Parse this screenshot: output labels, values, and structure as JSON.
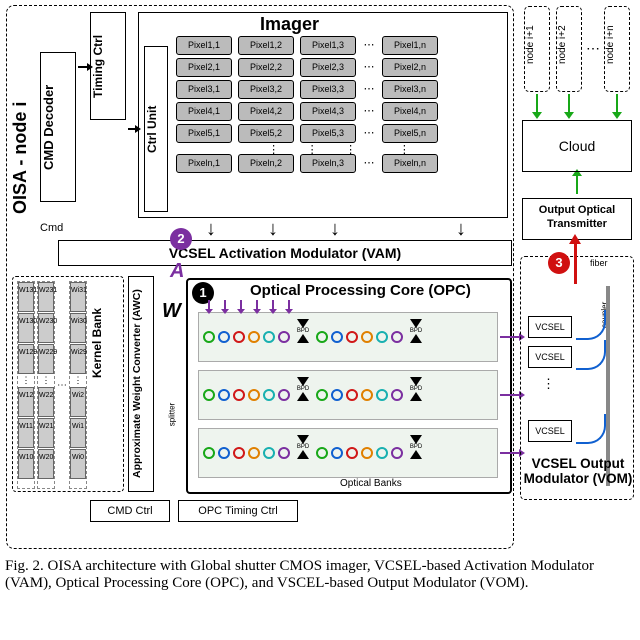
{
  "caption": "Fig. 2.  OISA architecture with Global shutter CMOS imager, VCSEL-based Activation Modulator (VAM), Optical Processing Core (OPC), and VSCEL-based Output Modulator (VOM).",
  "oisa_label": "OISA - node i",
  "blocks": {
    "cmd_decoder": "CMD Decoder",
    "timing_ctrl": "Timing Ctrl",
    "ctrl_unit": "Ctrl Unit",
    "imager_title": "Imager",
    "vam": "VCSEL Activation Modulator (VAM)",
    "kernel_bank": "Kernel Bank",
    "awc": "Approximate Weight Converter (AWC)",
    "opc_title": "Optical Processing Core (OPC)",
    "optical_banks": "Optical Banks",
    "splitter": "splitter",
    "cmd_ctrl": "CMD Ctrl",
    "opc_timing": "OPC Timing Ctrl",
    "cmd_input": "Cmd",
    "cloud": "Cloud",
    "oot": "Output Optical Transmitter",
    "vcsel": "VCSEL",
    "fiber": "fiber",
    "coupler": "coupler",
    "vom_title": "VCSEL Output Modulator (VOM)",
    "bpd": "BPD"
  },
  "badges": {
    "b1": "1",
    "b2": "2",
    "b3": "3"
  },
  "labels": {
    "A": "A",
    "W": "W"
  },
  "nodes": [
    "node i+1",
    "node i+2",
    "node i+n"
  ],
  "pixel_rows": [
    [
      "Pixel1,1",
      "Pixel1,2",
      "Pixel1,3",
      "Pixel1,n"
    ],
    [
      "Pixel2,1",
      "Pixel2,2",
      "Pixel2,3",
      "Pixel2,n"
    ],
    [
      "Pixel3,1",
      "Pixel3,2",
      "Pixel3,3",
      "Pixel3,n"
    ],
    [
      "Pixel4,1",
      "Pixel4,2",
      "Pixel4,3",
      "Pixel4,n"
    ],
    [
      "Pixel5,1",
      "Pixel5,2",
      "Pixel5,3",
      "Pixel5,n"
    ],
    [
      "Pixeln,1",
      "Pixeln,2",
      "Pixeln,3",
      "Pixeln,n"
    ]
  ],
  "kernel_cols": [
    [
      "W131",
      "W130",
      "W129",
      "W12",
      "W11",
      "W10"
    ],
    [
      "W231",
      "W230",
      "W229",
      "W22",
      "W21",
      "W20"
    ],
    [
      "Wi31",
      "Wi30",
      "Wi29",
      "Wi2",
      "Wi1",
      "Wi0"
    ]
  ]
}
